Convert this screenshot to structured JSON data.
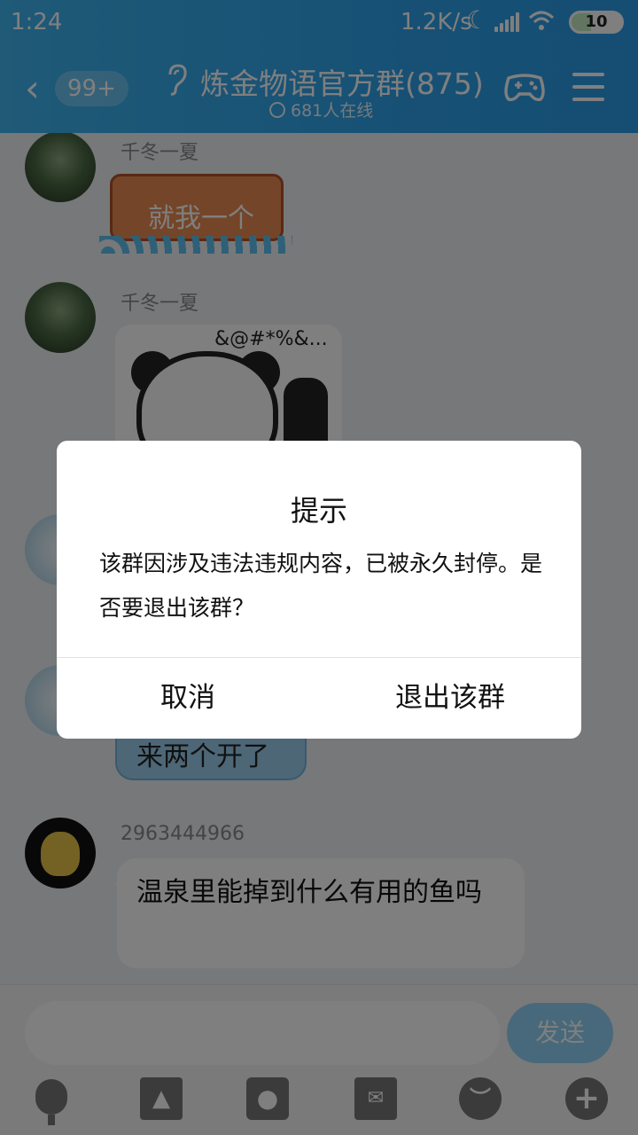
{
  "status_bar": {
    "time": "1:24",
    "net_speed": "1.2K/s",
    "battery": "10"
  },
  "header": {
    "unread_badge": "99+",
    "group_title": "炼金物语官方群(875)",
    "online_count": "681人在线",
    "icons": [
      "back-arrow-icon",
      "ear-icon",
      "game-controller-icon",
      "menu-icon"
    ]
  },
  "chat": {
    "messages": [
      {
        "sender": "千冬一夏",
        "content": "就我一个",
        "type": "fish-sticker"
      },
      {
        "sender": "千冬一夏",
        "content": "&@#*%&...",
        "type": "panda-sticker"
      },
      {
        "sender": "",
        "content": "来两个开了",
        "type": "bubble"
      },
      {
        "sender": "2963444966",
        "content": "温泉里能掉到什么有用的鱼吗",
        "type": "bubble"
      }
    ]
  },
  "input": {
    "placeholder": "",
    "send_label": "发送",
    "tools": [
      "microphone-icon",
      "image-icon",
      "camera-icon",
      "red-packet-icon",
      "emoji-icon",
      "plus-icon"
    ]
  },
  "dialog": {
    "title": "提示",
    "message": "该群因涉及违法违规内容，已被永久封停。是否要退出该群？",
    "cancel_label": "取消",
    "exit_label": "退出该群"
  },
  "colors": {
    "header": "#2ea2ea",
    "send_button": "#8fd3f7",
    "dialog_bg": "#ffffff"
  }
}
